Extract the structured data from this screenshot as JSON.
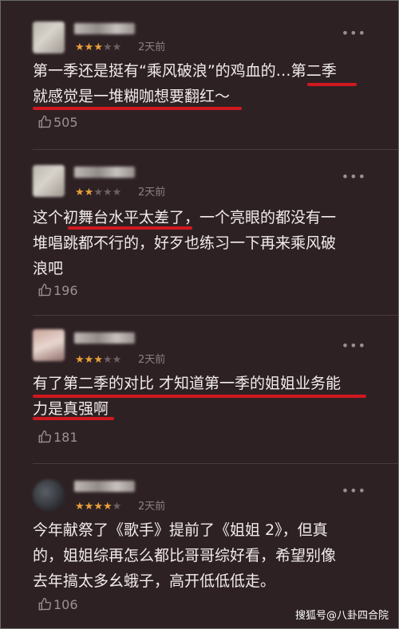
{
  "comments": [
    {
      "rating": 3,
      "time": "2天前",
      "lines": [
        "第一季还是挺有“乘风破浪”的鸡血的…第二季",
        "就感觉是一堆糊咖想要翻红～"
      ],
      "likes": "505"
    },
    {
      "rating": 2,
      "time": "2天前",
      "lines": [
        "这个初舞台水平太差了，一个亮眼的都没有一",
        "堆唱跳都不行的，好歹也练习一下再来乘风破",
        "浪吧"
      ],
      "likes": "196"
    },
    {
      "rating": 3,
      "time": "2天前",
      "lines": [
        "有了第二季的对比 才知道第一季的姐姐业务能",
        "力是真强啊"
      ],
      "likes": "181"
    },
    {
      "rating": 4,
      "time": "2天前",
      "lines": [
        "今年献祭了《歌手》提前了《姐姐 2》，但真",
        "的，姐姐综再怎么都比哥哥综好看，希望别像",
        "去年搞太多幺蛾子，高开低低低走。"
      ],
      "likes": "106"
    }
  ],
  "more_label": "•••",
  "watermark": "搜狐号@八卦四合院",
  "colors": {
    "background": "#2e2124",
    "text": "#f1ecec",
    "star_on": "#e7a13a",
    "underline": "#d0181f"
  }
}
